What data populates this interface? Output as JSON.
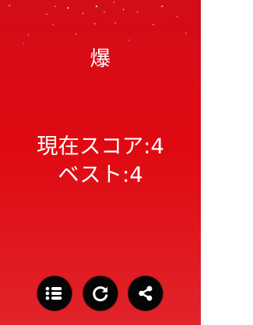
{
  "result": {
    "title": "爆"
  },
  "score": {
    "current_line": "現在スコア:4",
    "best_line": "ベスト:4"
  },
  "buttons": {
    "list_icon": "list-icon",
    "retry_icon": "refresh-icon",
    "share_icon": "share-icon"
  },
  "colors": {
    "background_top": "#d20d19",
    "background_bottom": "#e0242a",
    "text": "#ffffff",
    "button": "#050505"
  }
}
